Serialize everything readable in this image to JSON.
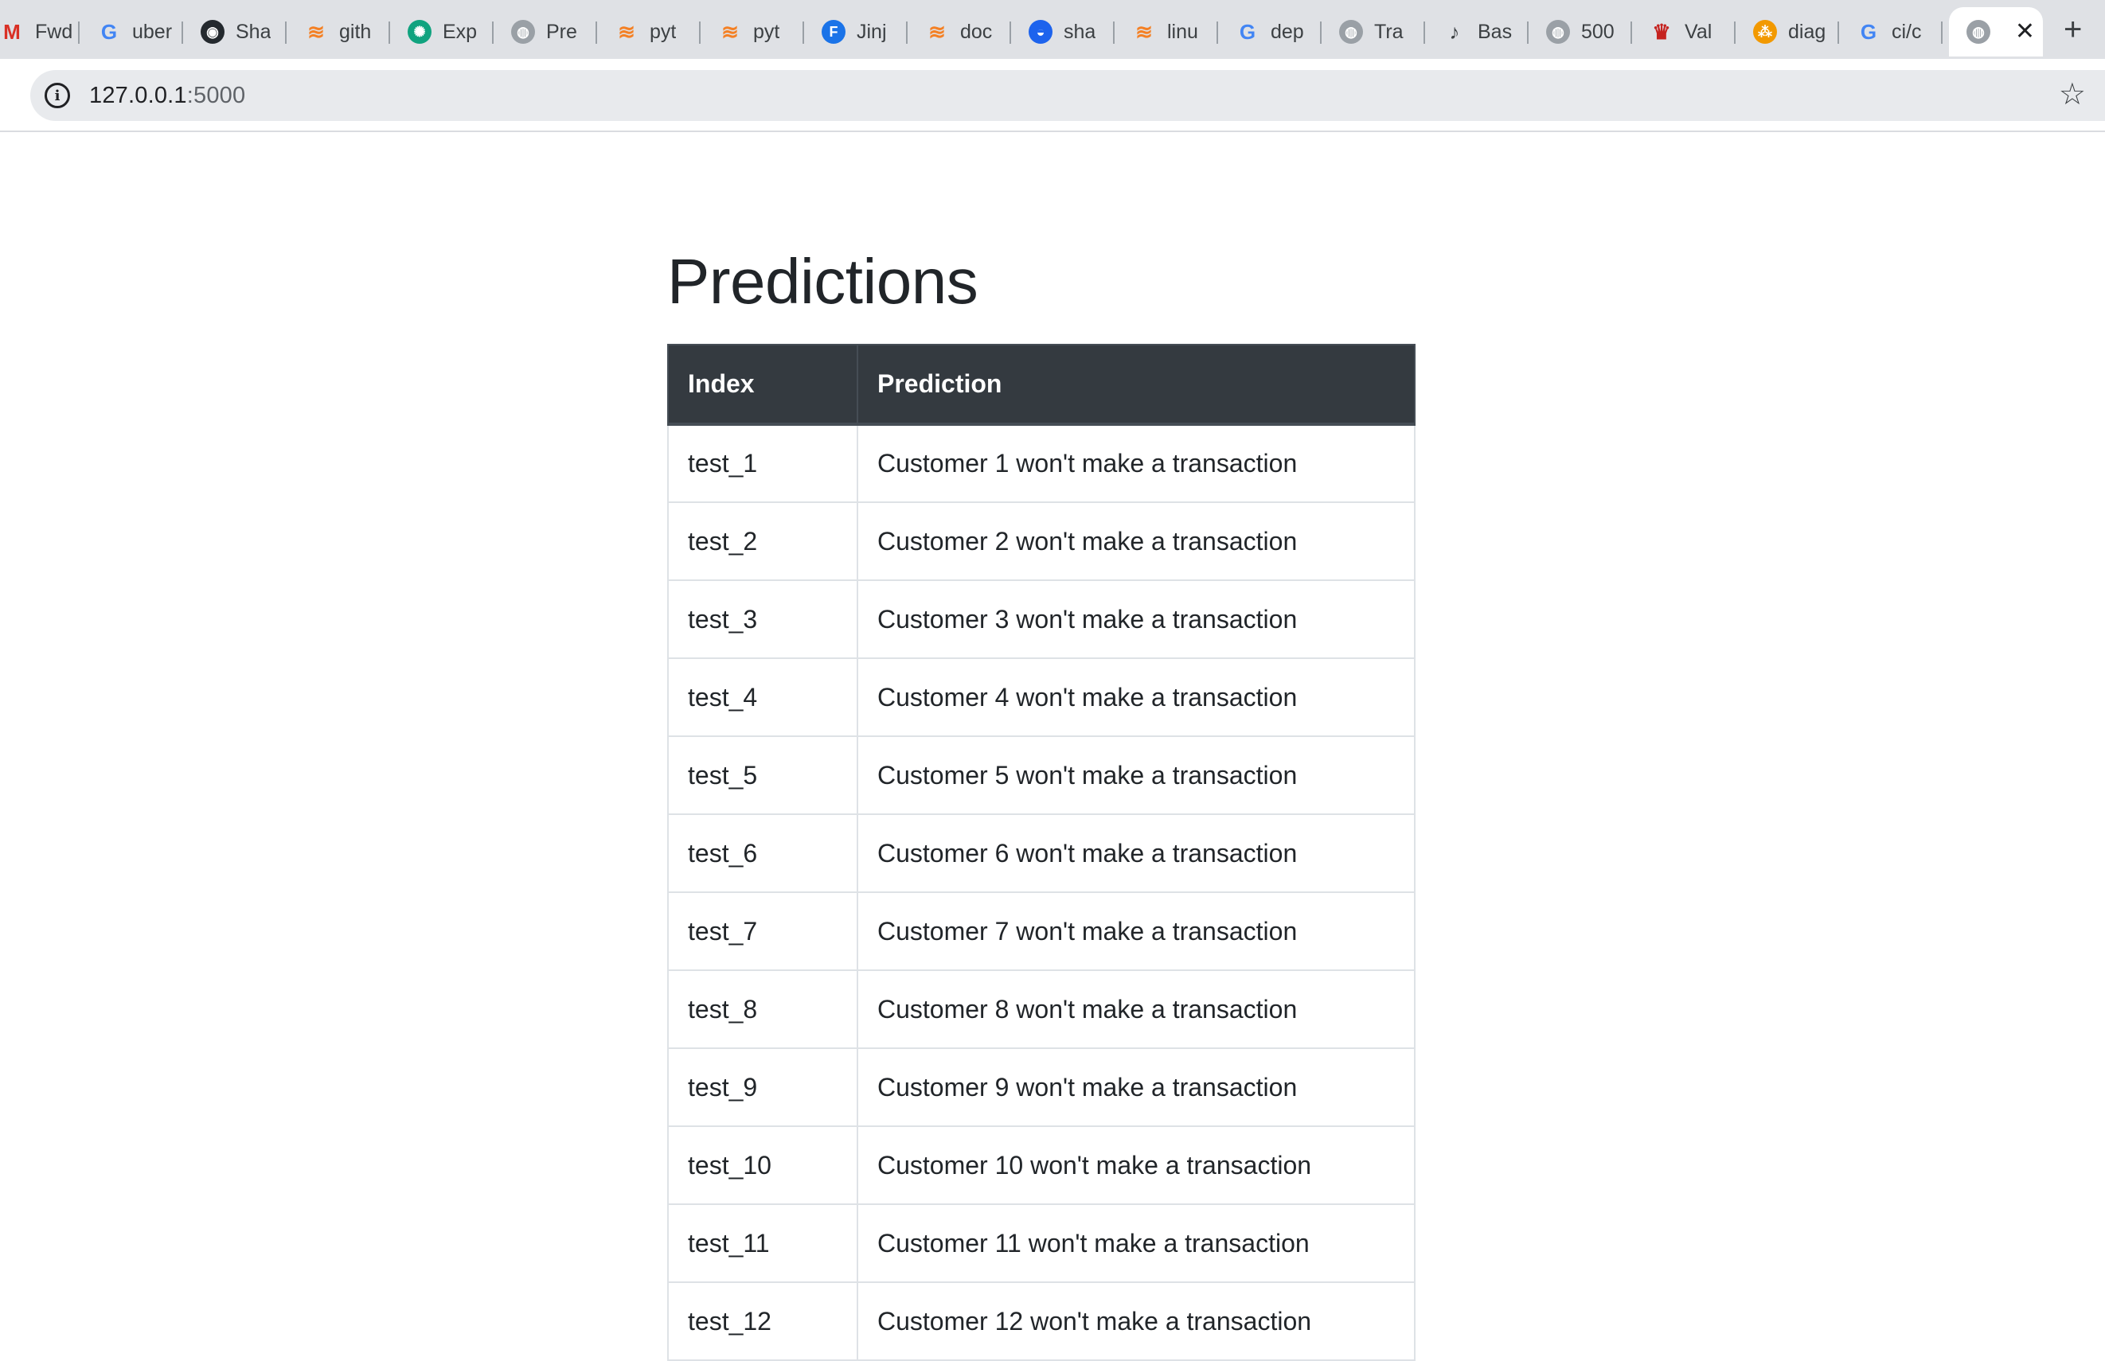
{
  "tabs": [
    {
      "label": "Fwd",
      "icon": "gmail-icon",
      "color": "#d93025"
    },
    {
      "label": "uber",
      "icon": "google-icon",
      "color": "#4285f4"
    },
    {
      "label": "Sha",
      "icon": "github-icon",
      "color": "#24292e"
    },
    {
      "label": "gith",
      "icon": "stackoverflow-icon",
      "color": "#f48024"
    },
    {
      "label": "Exp",
      "icon": "chatgpt-icon",
      "color": "#10a37f"
    },
    {
      "label": "Pre",
      "icon": "globe-icon",
      "color": "#9aa0a6"
    },
    {
      "label": "pyt",
      "icon": "stackoverflow-icon",
      "color": "#f48024"
    },
    {
      "label": "pyt",
      "icon": "stackoverflow-icon",
      "color": "#f48024"
    },
    {
      "label": "Jinj",
      "icon": "f-icon",
      "color": "#1a73e8"
    },
    {
      "label": "doc",
      "icon": "stackoverflow-icon",
      "color": "#f48024"
    },
    {
      "label": "sha",
      "icon": "docker-icon",
      "color": "#1d63ed"
    },
    {
      "label": "linu",
      "icon": "stackoverflow-icon",
      "color": "#f48024"
    },
    {
      "label": "dep",
      "icon": "google-icon",
      "color": "#4285f4"
    },
    {
      "label": "Tra",
      "icon": "globe-icon",
      "color": "#9aa0a6"
    },
    {
      "label": "Bas",
      "icon": "guitar-icon",
      "color": "#3c4043"
    },
    {
      "label": "500",
      "icon": "globe-icon",
      "color": "#9aa0a6"
    },
    {
      "label": "Val",
      "icon": "crown-icon",
      "color": "#c5221f"
    },
    {
      "label": "diag",
      "icon": "diagram-icon",
      "color": "#f29900"
    },
    {
      "label": "ci/c",
      "icon": "google-icon",
      "color": "#4285f4"
    }
  ],
  "active_tab": {
    "icon": "globe-icon",
    "close": "✕"
  },
  "new_tab": "+",
  "address": {
    "host": "127.0.0.1",
    "port": ":5000"
  },
  "page": {
    "title": "Predictions",
    "headers": {
      "index": "Index",
      "prediction": "Prediction"
    },
    "rows": [
      {
        "index": "test_1",
        "prediction": "Customer 1 won't make a transaction"
      },
      {
        "index": "test_2",
        "prediction": "Customer 2 won't make a transaction"
      },
      {
        "index": "test_3",
        "prediction": "Customer 3 won't make a transaction"
      },
      {
        "index": "test_4",
        "prediction": "Customer 4 won't make a transaction"
      },
      {
        "index": "test_5",
        "prediction": "Customer 5 won't make a transaction"
      },
      {
        "index": "test_6",
        "prediction": "Customer 6 won't make a transaction"
      },
      {
        "index": "test_7",
        "prediction": "Customer 7 won't make a transaction"
      },
      {
        "index": "test_8",
        "prediction": "Customer 8 won't make a transaction"
      },
      {
        "index": "test_9",
        "prediction": "Customer 9 won't make a transaction"
      },
      {
        "index": "test_10",
        "prediction": "Customer 10 won't make a transaction"
      },
      {
        "index": "test_11",
        "prediction": "Customer 11 won't make a transaction"
      },
      {
        "index": "test_12",
        "prediction": "Customer 12 won't make a transaction"
      }
    ]
  }
}
